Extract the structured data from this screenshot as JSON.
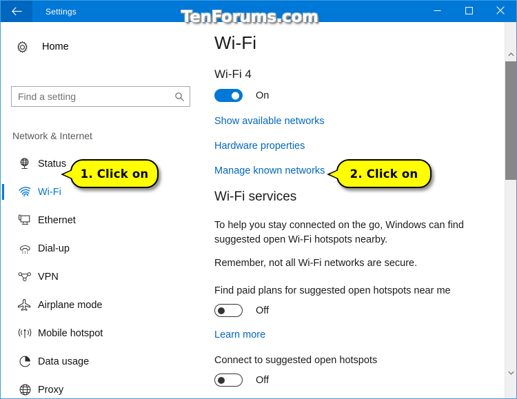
{
  "window": {
    "title": "Settings",
    "back_icon": "back-arrow-icon",
    "minimize_label": "–",
    "maximize_label": "□",
    "close_label": "✕"
  },
  "watermark": {
    "text": "TenForums.com"
  },
  "sidebar": {
    "home": {
      "label": "Home",
      "icon": "gear-icon"
    },
    "search": {
      "placeholder": "Find a setting",
      "value": "",
      "icon": "search-icon"
    },
    "group_title": "Network & Internet",
    "items": [
      {
        "label": "Status",
        "icon": "globe-status-icon",
        "selected": false
      },
      {
        "label": "Wi-Fi",
        "icon": "wifi-icon",
        "selected": true
      },
      {
        "label": "Ethernet",
        "icon": "ethernet-icon",
        "selected": false
      },
      {
        "label": "Dial-up",
        "icon": "dialup-phone-icon",
        "selected": false
      },
      {
        "label": "VPN",
        "icon": "vpn-icon",
        "selected": false
      },
      {
        "label": "Airplane mode",
        "icon": "airplane-icon",
        "selected": false
      },
      {
        "label": "Mobile hotspot",
        "icon": "mobile-hotspot-icon",
        "selected": false
      },
      {
        "label": "Data usage",
        "icon": "pie-chart-icon",
        "selected": false
      },
      {
        "label": "Proxy",
        "icon": "globe-proxy-icon",
        "selected": false
      }
    ]
  },
  "main": {
    "page_title": "Wi-Fi",
    "adapter": {
      "name": "Wi-Fi 4",
      "toggle_state": "On",
      "toggle_on": true
    },
    "links": [
      {
        "label": "Show available networks"
      },
      {
        "label": "Hardware properties"
      },
      {
        "label": "Manage known networks"
      }
    ],
    "services": {
      "heading": "Wi-Fi services",
      "paragraph_1": "To help you stay connected on the go, Windows can find suggested open Wi-Fi hotspots nearby.",
      "paragraph_2": "Remember, not all Wi-Fi networks are secure.",
      "setting_1": {
        "label": "Find paid plans for suggested open hotspots near me",
        "toggle_state": "Off",
        "toggle_on": false
      },
      "learn_more": "Learn more",
      "setting_2": {
        "label": "Connect to suggested open hotspots",
        "toggle_state": "Off",
        "toggle_on": false
      }
    }
  },
  "callouts": [
    {
      "text": "1. Click on"
    },
    {
      "text": "2. Click on"
    }
  ],
  "colors": {
    "titlebar_blue": "#0078d7",
    "accent_blue": "#0078d7",
    "link_blue": "#0067c0",
    "callout_yellow": "#ffff00",
    "window_border": "#3b9ce0"
  }
}
